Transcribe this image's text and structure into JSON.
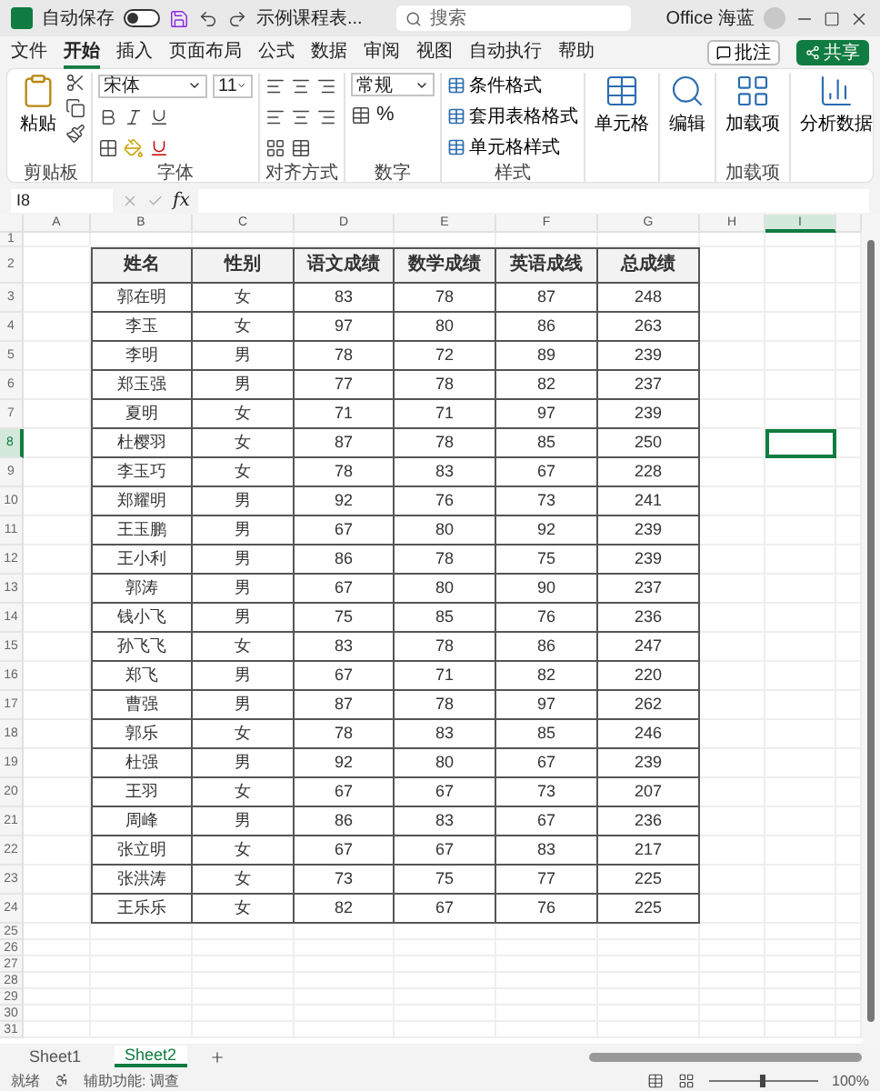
{
  "title_bar": {
    "autosave_label": "自动保存",
    "autosave_on": false,
    "file_name": "示例课程表...",
    "search_placeholder": "搜索",
    "user": "Office 海蓝"
  },
  "menu_tabs": [
    {
      "label": "文件",
      "selected": false
    },
    {
      "label": "开始",
      "selected": true
    },
    {
      "label": "插入",
      "selected": false
    },
    {
      "label": "页面布局",
      "selected": false
    },
    {
      "label": "公式",
      "selected": false
    },
    {
      "label": "数据",
      "selected": false
    },
    {
      "label": "审阅",
      "selected": false
    },
    {
      "label": "视图",
      "selected": false
    },
    {
      "label": "自动执行",
      "selected": false
    },
    {
      "label": "帮助",
      "selected": false
    }
  ],
  "comments_button": "批注",
  "share_button": "共享",
  "ribbon": [
    {
      "kind": "clipboard",
      "label": "剪贴板",
      "button": "粘贴"
    },
    {
      "kind": "font",
      "label": "字体",
      "font": "宋体",
      "size": "11"
    },
    {
      "kind": "align",
      "label": "对齐方式"
    },
    {
      "kind": "number",
      "label": "数字",
      "format": "常规",
      "percent": "%"
    },
    {
      "kind": "styles",
      "label": "样式",
      "items": [
        "条件格式",
        "套用表格格式",
        "单元格样式"
      ]
    },
    {
      "kind": "big",
      "button": "单元格"
    },
    {
      "kind": "big",
      "button": "编辑"
    },
    {
      "kind": "big",
      "label": "加载项",
      "button": "加载项"
    },
    {
      "kind": "big",
      "button": "分析数据"
    }
  ],
  "formula_bar": {
    "name_box": "I8",
    "fx": "fx"
  },
  "sheet": {
    "columns": [
      {
        "label": "A",
        "selected": false
      },
      {
        "label": "B",
        "selected": false
      },
      {
        "label": "C",
        "selected": false
      },
      {
        "label": "D",
        "selected": false
      },
      {
        "label": "E",
        "selected": false
      },
      {
        "label": "F",
        "selected": false
      },
      {
        "label": "G",
        "selected": false
      },
      {
        "label": "H",
        "selected": false
      },
      {
        "label": "I",
        "selected": true
      }
    ],
    "rows": [
      {
        "number": "1",
        "selected": false
      },
      {
        "number": "2",
        "selected": false
      },
      {
        "number": "3",
        "selected": false
      },
      {
        "number": "4",
        "selected": false
      },
      {
        "number": "5",
        "selected": false
      },
      {
        "number": "6",
        "selected": false
      },
      {
        "number": "7",
        "selected": false
      },
      {
        "number": "8",
        "selected": true
      },
      {
        "number": "9",
        "selected": false
      },
      {
        "number": "10",
        "selected": false
      },
      {
        "number": "11",
        "selected": false
      },
      {
        "number": "12",
        "selected": false
      },
      {
        "number": "13",
        "selected": false
      },
      {
        "number": "14",
        "selected": false
      },
      {
        "number": "15",
        "selected": false
      },
      {
        "number": "16",
        "selected": false
      },
      {
        "number": "17",
        "selected": false
      },
      {
        "number": "18",
        "selected": false
      },
      {
        "number": "19",
        "selected": false
      },
      {
        "number": "20",
        "selected": false
      },
      {
        "number": "21",
        "selected": false
      },
      {
        "number": "22",
        "selected": false
      },
      {
        "number": "23",
        "selected": false
      },
      {
        "number": "24",
        "selected": false
      },
      {
        "number": "25",
        "selected": false
      },
      {
        "number": "26",
        "selected": false
      },
      {
        "number": "27",
        "selected": false
      },
      {
        "number": "28",
        "selected": false
      },
      {
        "number": "29",
        "selected": false
      },
      {
        "number": "30",
        "selected": false
      },
      {
        "number": "31",
        "selected": false
      }
    ],
    "table": {
      "header": [
        "姓名",
        "性别",
        "语文成绩",
        "数学成绩",
        "英语成线",
        "总成绩"
      ],
      "rows": [
        [
          "郭在明",
          "女",
          "83",
          "78",
          "87",
          "248"
        ],
        [
          "李玉",
          "女",
          "97",
          "80",
          "86",
          "263"
        ],
        [
          "李明",
          "男",
          "78",
          "72",
          "89",
          "239"
        ],
        [
          "郑玉强",
          "男",
          "77",
          "78",
          "82",
          "237"
        ],
        [
          "夏明",
          "女",
          "71",
          "71",
          "97",
          "239"
        ],
        [
          "杜樱羽",
          "女",
          "87",
          "78",
          "85",
          "250"
        ],
        [
          "李玉巧",
          "女",
          "78",
          "83",
          "67",
          "228"
        ],
        [
          "郑耀明",
          "男",
          "92",
          "76",
          "73",
          "241"
        ],
        [
          "王玉鹏",
          "男",
          "67",
          "80",
          "92",
          "239"
        ],
        [
          "王小利",
          "男",
          "86",
          "78",
          "75",
          "239"
        ],
        [
          "郭涛",
          "男",
          "67",
          "80",
          "90",
          "237"
        ],
        [
          "钱小飞",
          "男",
          "75",
          "85",
          "76",
          "236"
        ],
        [
          "孙飞飞",
          "女",
          "83",
          "78",
          "86",
          "247"
        ],
        [
          "郑飞",
          "男",
          "67",
          "71",
          "82",
          "220"
        ],
        [
          "曹强",
          "男",
          "87",
          "78",
          "97",
          "262"
        ],
        [
          "郭乐",
          "女",
          "78",
          "83",
          "85",
          "246"
        ],
        [
          "杜强",
          "男",
          "92",
          "80",
          "67",
          "239"
        ],
        [
          "王羽",
          "女",
          "67",
          "67",
          "73",
          "207"
        ],
        [
          "周峰",
          "男",
          "86",
          "83",
          "67",
          "236"
        ],
        [
          "张立明",
          "女",
          "67",
          "67",
          "83",
          "217"
        ],
        [
          "张洪涛",
          "女",
          "73",
          "75",
          "77",
          "225"
        ],
        [
          "王乐乐",
          "女",
          "82",
          "67",
          "76",
          "225"
        ]
      ]
    }
  },
  "sheet_tabs": [
    {
      "label": "Sheet1",
      "selected": false
    },
    {
      "label": "Sheet2",
      "selected": true
    }
  ],
  "status_bar": {
    "ready": "就绪",
    "accessibility": "辅助功能: 调查",
    "zoom": "100%"
  }
}
